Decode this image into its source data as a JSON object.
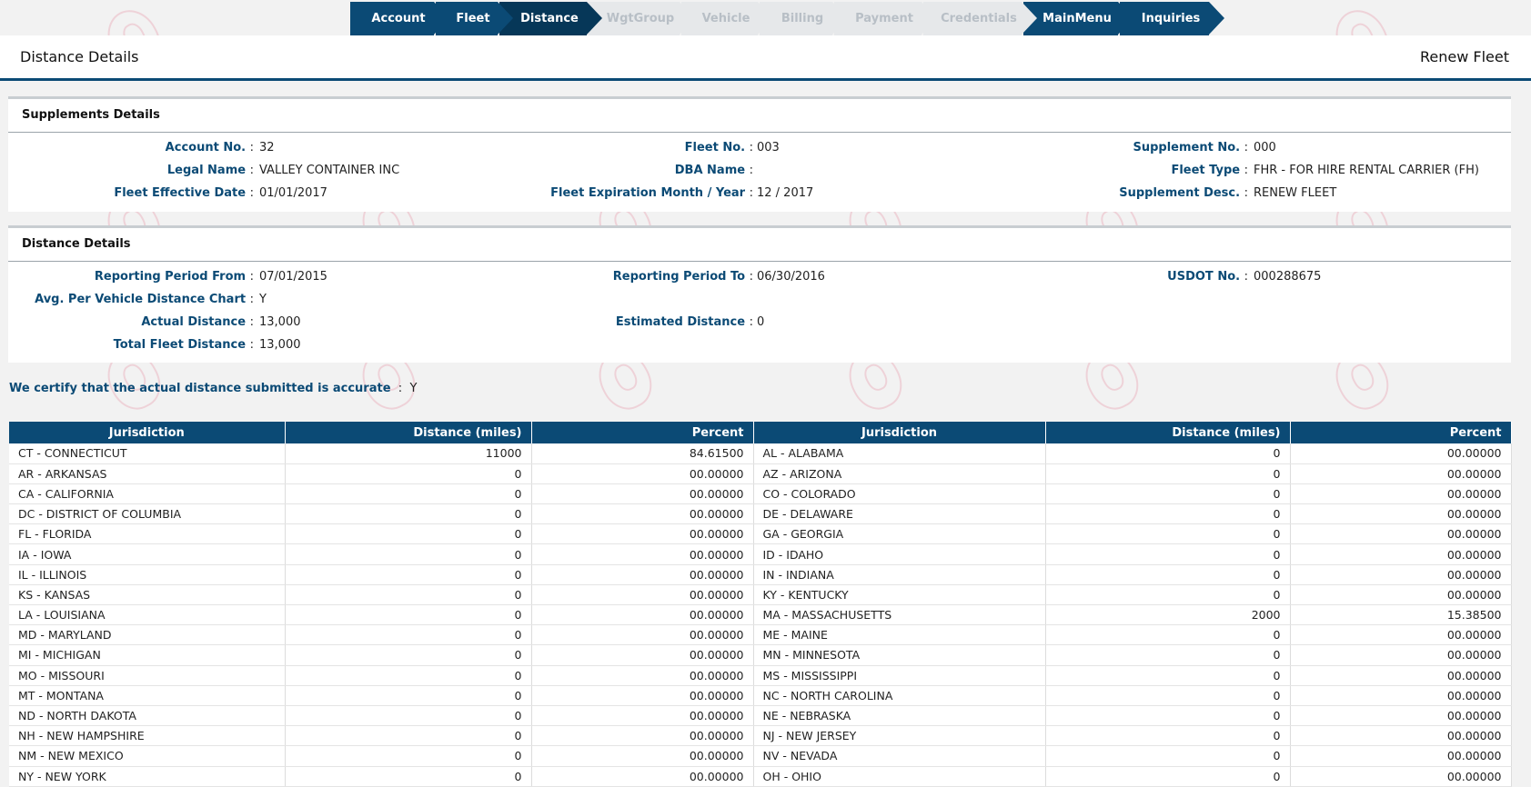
{
  "wizard": [
    {
      "label": "Account",
      "state": "done"
    },
    {
      "label": "Fleet",
      "state": "done"
    },
    {
      "label": "Distance",
      "state": "current"
    },
    {
      "label": "WgtGroup",
      "state": "disabled"
    },
    {
      "label": "Vehicle",
      "state": "disabled"
    },
    {
      "label": "Billing",
      "state": "disabled"
    },
    {
      "label": "Payment",
      "state": "disabled"
    },
    {
      "label": "Credentials",
      "state": "disabled"
    },
    {
      "label": "MainMenu",
      "state": "done"
    },
    {
      "label": "Inquiries",
      "state": "done"
    }
  ],
  "header": {
    "title": "Distance Details",
    "context": "Renew Fleet"
  },
  "supplements": {
    "heading": "Supplements Details",
    "account_no_label": "Account No.",
    "account_no": "32",
    "fleet_no_label": "Fleet No.",
    "fleet_no": "003",
    "supplement_no_label": "Supplement No.",
    "supplement_no": "000",
    "legal_name_label": "Legal Name",
    "legal_name": "VALLEY CONTAINER INC",
    "dba_name_label": "DBA Name",
    "dba_name": "",
    "fleet_type_label": "Fleet Type",
    "fleet_type": "FHR - FOR HIRE RENTAL CARRIER (FH)",
    "fleet_effective_label": "Fleet Effective Date",
    "fleet_effective": "01/01/2017",
    "fleet_expiration_label": "Fleet Expiration Month / Year",
    "fleet_expiration": "12 / 2017",
    "supplement_desc_label": "Supplement Desc.",
    "supplement_desc": "RENEW FLEET"
  },
  "distance": {
    "heading": "Distance Details",
    "period_from_label": "Reporting Period From",
    "period_from": "07/01/2015",
    "period_to_label": "Reporting Period To",
    "period_to": "06/30/2016",
    "usdot_label": "USDOT No.",
    "usdot": "000288675",
    "avg_chart_label": "Avg. Per Vehicle Distance Chart",
    "avg_chart": "Y",
    "actual_label": "Actual Distance",
    "actual": "13,000",
    "estimated_label": "Estimated Distance",
    "estimated": "0",
    "total_label": "Total Fleet Distance",
    "total": "13,000"
  },
  "certify": {
    "label": "We certify that the actual distance submitted is accurate",
    "value": "Y"
  },
  "table": {
    "headers": [
      "Jurisdiction",
      "Distance (miles)",
      "Percent",
      "Jurisdiction",
      "Distance (miles)",
      "Percent"
    ],
    "rows": [
      [
        "CT - CONNECTICUT",
        "11000",
        "84.61500",
        "AL - ALABAMA",
        "0",
        "00.00000"
      ],
      [
        "AR - ARKANSAS",
        "0",
        "00.00000",
        "AZ - ARIZONA",
        "0",
        "00.00000"
      ],
      [
        "CA - CALIFORNIA",
        "0",
        "00.00000",
        "CO - COLORADO",
        "0",
        "00.00000"
      ],
      [
        "DC - DISTRICT OF COLUMBIA",
        "0",
        "00.00000",
        "DE - DELAWARE",
        "0",
        "00.00000"
      ],
      [
        "FL - FLORIDA",
        "0",
        "00.00000",
        "GA - GEORGIA",
        "0",
        "00.00000"
      ],
      [
        "IA - IOWA",
        "0",
        "00.00000",
        "ID - IDAHO",
        "0",
        "00.00000"
      ],
      [
        "IL - ILLINOIS",
        "0",
        "00.00000",
        "IN - INDIANA",
        "0",
        "00.00000"
      ],
      [
        "KS - KANSAS",
        "0",
        "00.00000",
        "KY - KENTUCKY",
        "0",
        "00.00000"
      ],
      [
        "LA - LOUISIANA",
        "0",
        "00.00000",
        "MA - MASSACHUSETTS",
        "2000",
        "15.38500"
      ],
      [
        "MD - MARYLAND",
        "0",
        "00.00000",
        "ME - MAINE",
        "0",
        "00.00000"
      ],
      [
        "MI - MICHIGAN",
        "0",
        "00.00000",
        "MN - MINNESOTA",
        "0",
        "00.00000"
      ],
      [
        "MO - MISSOURI",
        "0",
        "00.00000",
        "MS - MISSISSIPPI",
        "0",
        "00.00000"
      ],
      [
        "MT - MONTANA",
        "0",
        "00.00000",
        "NC - NORTH CAROLINA",
        "0",
        "00.00000"
      ],
      [
        "ND - NORTH DAKOTA",
        "0",
        "00.00000",
        "NE - NEBRASKA",
        "0",
        "00.00000"
      ],
      [
        "NH - NEW HAMPSHIRE",
        "0",
        "00.00000",
        "NJ - NEW JERSEY",
        "0",
        "00.00000"
      ],
      [
        "NM - NEW MEXICO",
        "0",
        "00.00000",
        "NV - NEVADA",
        "0",
        "00.00000"
      ],
      [
        "NY - NEW YORK",
        "0",
        "00.00000",
        "OH - OHIO",
        "0",
        "00.00000"
      ]
    ]
  },
  "colors": {
    "primary": "#0b4a75",
    "current_step": "#063758",
    "disabled_step": "#e6e8ea"
  }
}
